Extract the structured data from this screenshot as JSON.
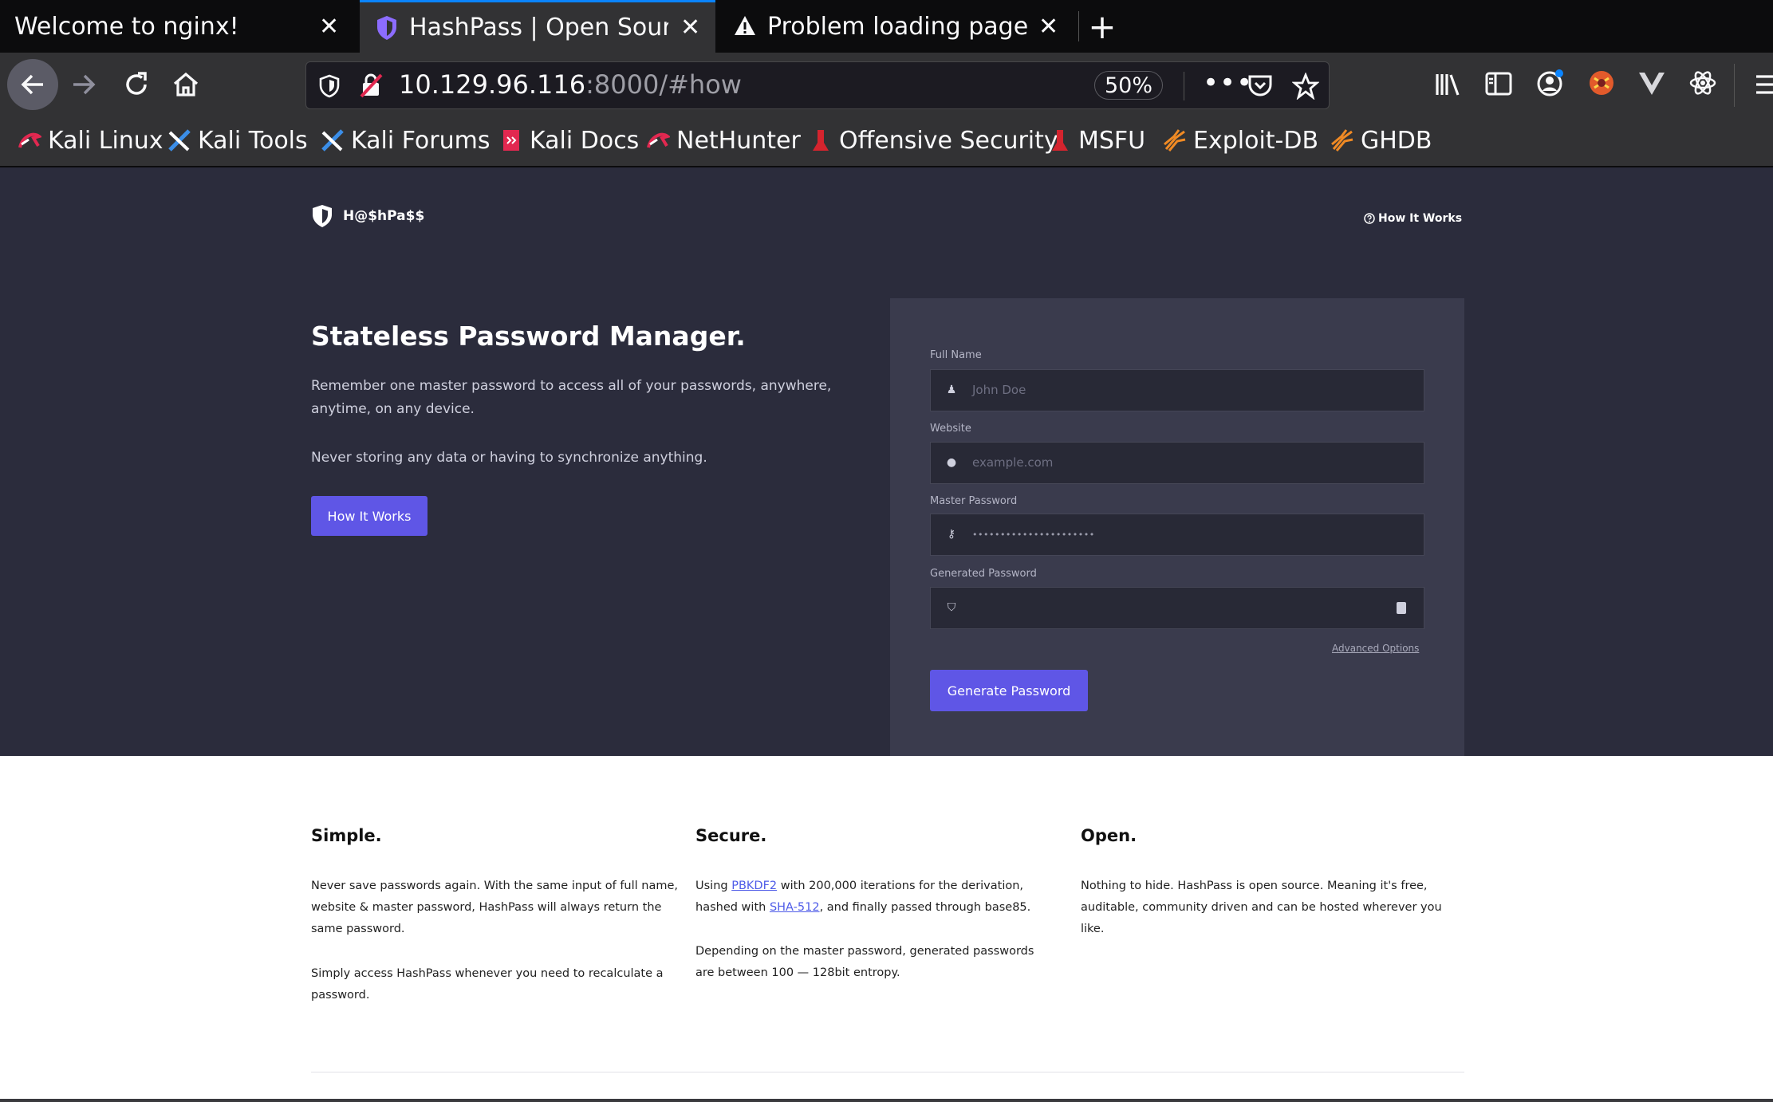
{
  "browser": {
    "tabs": [
      {
        "title": "Welcome to nginx!"
      },
      {
        "title": "HashPass | Open Source"
      },
      {
        "title": "Problem loading page"
      }
    ],
    "new_tab_label": "+",
    "url_host": "10.129.96.116",
    "url_rest": ":8000/#how",
    "zoom": "50%",
    "bookmarks": [
      {
        "label": "Kali Linux"
      },
      {
        "label": "Kali Tools"
      },
      {
        "label": "Kali Forums"
      },
      {
        "label": "Kali Docs"
      },
      {
        "label": "NetHunter"
      },
      {
        "label": "Offensive Security"
      },
      {
        "label": "MSFU"
      },
      {
        "label": "Exploit-DB"
      },
      {
        "label": "GHDB"
      }
    ],
    "accent_color": "#0a84ff"
  },
  "site": {
    "logo_text": "H@$hPa$$",
    "nav_link": "How It Works",
    "hero": {
      "headline": "Stateless Password Manager.",
      "para1": "Remember one master password to access all of your passwords, anywhere, anytime, on any device.",
      "para2": "Never storing any data or having to synchronize anything.",
      "button": "How It Works"
    },
    "form": {
      "full_name_label": "Full Name",
      "full_name_placeholder": "John Doe",
      "website_label": "Website",
      "website_placeholder": "example.com",
      "master_label": "Master Password",
      "master_value": "••••••••••••••••••••••",
      "generated_label": "Generated Password",
      "generated_value": "",
      "advanced": "Advanced Options",
      "submit": "Generate Password"
    },
    "features": [
      {
        "title": "Simple.",
        "p1": "Never save passwords again. With the same input of full name, website & master password, HashPass will always return the same password.",
        "p2": "Simply access HashPass whenever you need to recalculate a password."
      },
      {
        "title": "Secure.",
        "p1_pre": "Using ",
        "p1_link1": "PBKDF2",
        "p1_mid": " with 200,000 iterations for the derivation, hashed with ",
        "p1_link2": "SHA-512",
        "p1_post": ", and finally passed through base85.",
        "p2": "Depending on the master password, generated passwords are between 100 — 128bit entropy."
      },
      {
        "title": "Open.",
        "p1": "Nothing to hide. HashPass is open source. Meaning it's free, auditable, community driven and can be hosted wherever you like."
      }
    ],
    "brand_color": "#5f56e6",
    "hero_bg": "#2b2c3c"
  }
}
